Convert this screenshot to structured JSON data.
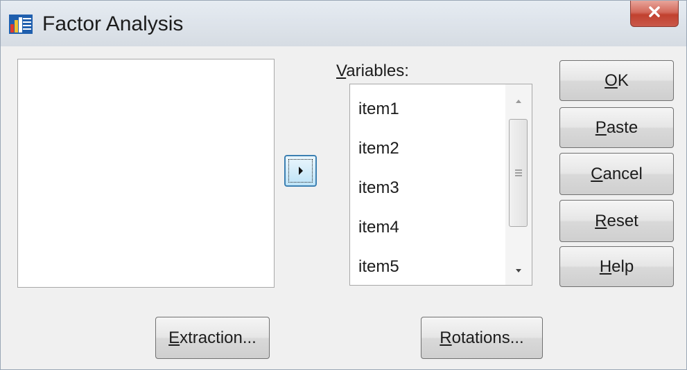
{
  "window": {
    "title": "Factor Analysis"
  },
  "variables": {
    "label": "Variables:",
    "mnemonic": "V",
    "items": [
      "item1",
      "item2",
      "item3",
      "item4",
      "item5"
    ]
  },
  "buttons": {
    "ok": {
      "mnemonic": "O",
      "rest": "K"
    },
    "paste": {
      "mnemonic": "P",
      "rest": "aste"
    },
    "cancel": {
      "mnemonic": "C",
      "rest": "ancel"
    },
    "reset": {
      "mnemonic": "R",
      "rest": "eset"
    },
    "help": {
      "mnemonic": "H",
      "rest": "elp"
    },
    "extraction": {
      "mnemonic": "E",
      "rest": "xtraction..."
    },
    "rotations": {
      "mnemonic": "R",
      "rest": "otations..."
    }
  },
  "icons": {
    "app": "factor-analysis-app-icon",
    "close": "close-icon",
    "move": "move-right-arrow-icon",
    "scroll_up": "scroll-up-arrow-icon",
    "scroll_down": "scroll-down-arrow-icon"
  },
  "colors": {
    "close_button": "#c9584a",
    "arrow_button": "#bde3f7",
    "window_background": "#f0f0f0"
  }
}
